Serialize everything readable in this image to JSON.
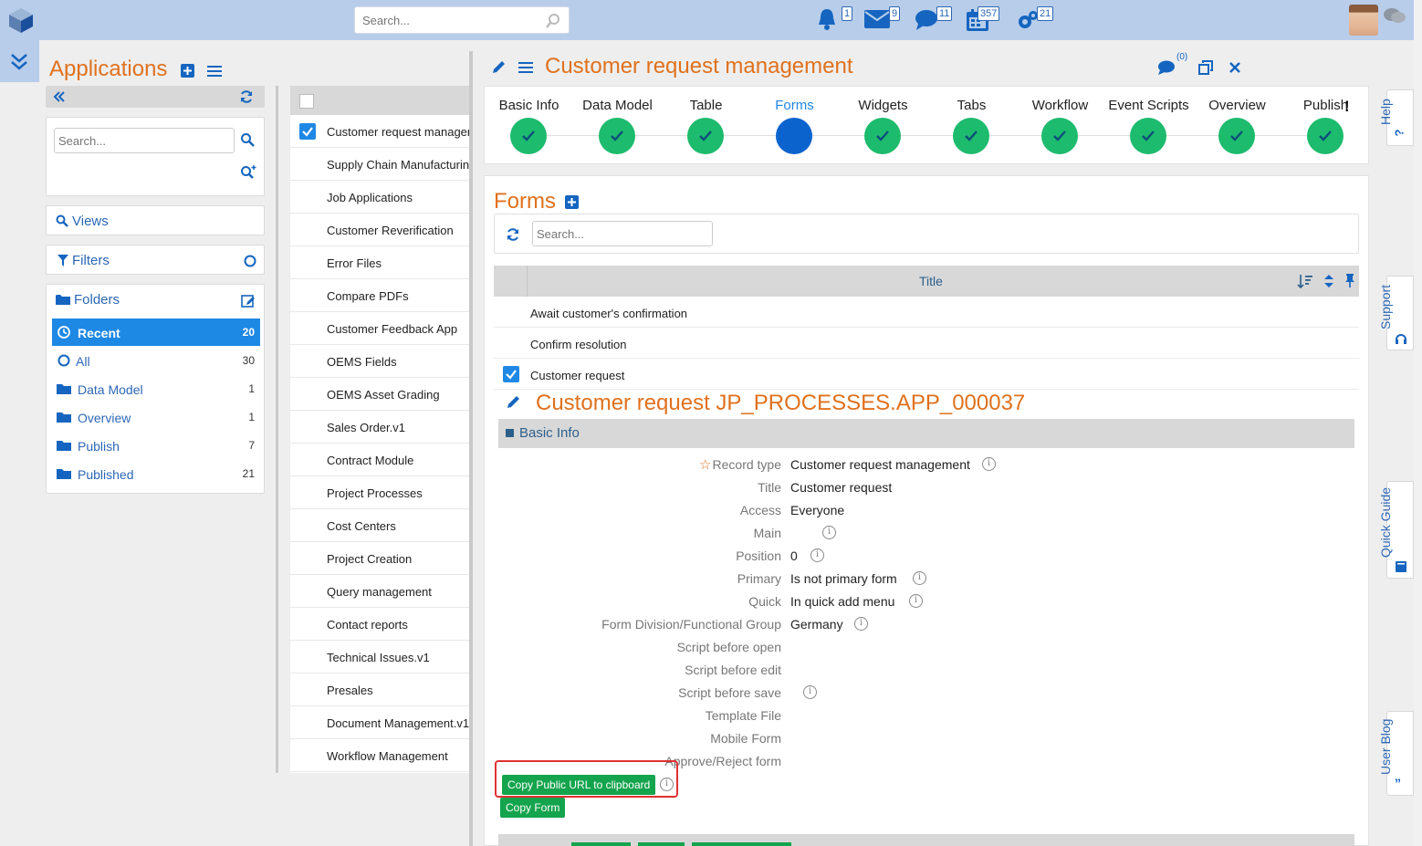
{
  "header": {
    "search_placeholder": "Search...",
    "badges": {
      "notifications": "1",
      "mail": "9",
      "chat": "11",
      "calendar": "357",
      "settings": "21"
    }
  },
  "apps_panel": {
    "title": "Applications",
    "search_placeholder": "Search...",
    "views_label": "Views",
    "filters_label": "Filters",
    "folders_label": "Folders",
    "folders": [
      {
        "label": "Recent",
        "count": "20",
        "icon": "clock-icon"
      },
      {
        "label": "All",
        "count": "30",
        "icon": "circle-icon"
      },
      {
        "label": "Data Model",
        "count": "1",
        "icon": "folder-icon"
      },
      {
        "label": "Overview",
        "count": "1",
        "icon": "folder-icon"
      },
      {
        "label": "Publish",
        "count": "7",
        "icon": "folder-icon"
      },
      {
        "label": "Published",
        "count": "21",
        "icon": "folder-icon"
      }
    ]
  },
  "app_list": [
    "Customer request management",
    "Supply Chain Manufacturing",
    "Job Applications",
    "Customer Reverification",
    "Error Files",
    "Compare PDFs",
    "Customer Feedback App",
    "OEMS Fields",
    "OEMS Asset Grading",
    "Sales Order.v1",
    "Contract Module",
    "Project Processes",
    "Cost Centers",
    "Project Creation",
    "Query management",
    "Contact reports",
    "Technical Issues.v1",
    "Presales",
    "Document Management.v1",
    "Workflow Management"
  ],
  "main": {
    "title": "Customer request management",
    "comment_count": "(0)",
    "steps": [
      "Basic Info",
      "Data Model",
      "Table",
      "Forms",
      "Widgets",
      "Tabs",
      "Workflow",
      "Event Scripts",
      "Overview",
      "Publish"
    ],
    "active_step": "Forms",
    "forms_title": "Forms",
    "forms_search_placeholder": "Search...",
    "grid_column": "Title",
    "grid_rows": [
      "Await customer's confirmation",
      "Confirm resolution",
      "Customer request"
    ],
    "record_title": "Customer request JP_PROCESSES.APP_000037",
    "section": "Basic Info",
    "fields": [
      {
        "key": "Record type",
        "value": "Customer request management"
      },
      {
        "key": "Title",
        "value": "Customer request"
      },
      {
        "key": "Access",
        "value": "Everyone"
      },
      {
        "key": "Main",
        "value": ""
      },
      {
        "key": "Position",
        "value": "0"
      },
      {
        "key": "Primary",
        "value": "Is not primary form"
      },
      {
        "key": "Quick",
        "value": "In quick add menu"
      },
      {
        "key": "Form Division/Functional Group",
        "value": "Germany"
      },
      {
        "key": "Script before open",
        "value": ""
      },
      {
        "key": "Script before edit",
        "value": ""
      },
      {
        "key": "Script before save",
        "value": ""
      },
      {
        "key": "Template File",
        "value": ""
      },
      {
        "key": "Mobile Form",
        "value": ""
      },
      {
        "key": "Approve/Reject form",
        "value": ""
      }
    ],
    "copy_url_button": "Copy Public URL to clipboard",
    "copy_form_button": "Copy Form"
  },
  "side_tabs": [
    "Help",
    "Support",
    "Quick Guide",
    "User Blog"
  ],
  "colors": {
    "accent_orange": "#e0711d",
    "primary_blue": "#1e88e5",
    "success_green": "#1dbb6d",
    "header_bg": "#b8cdea"
  }
}
